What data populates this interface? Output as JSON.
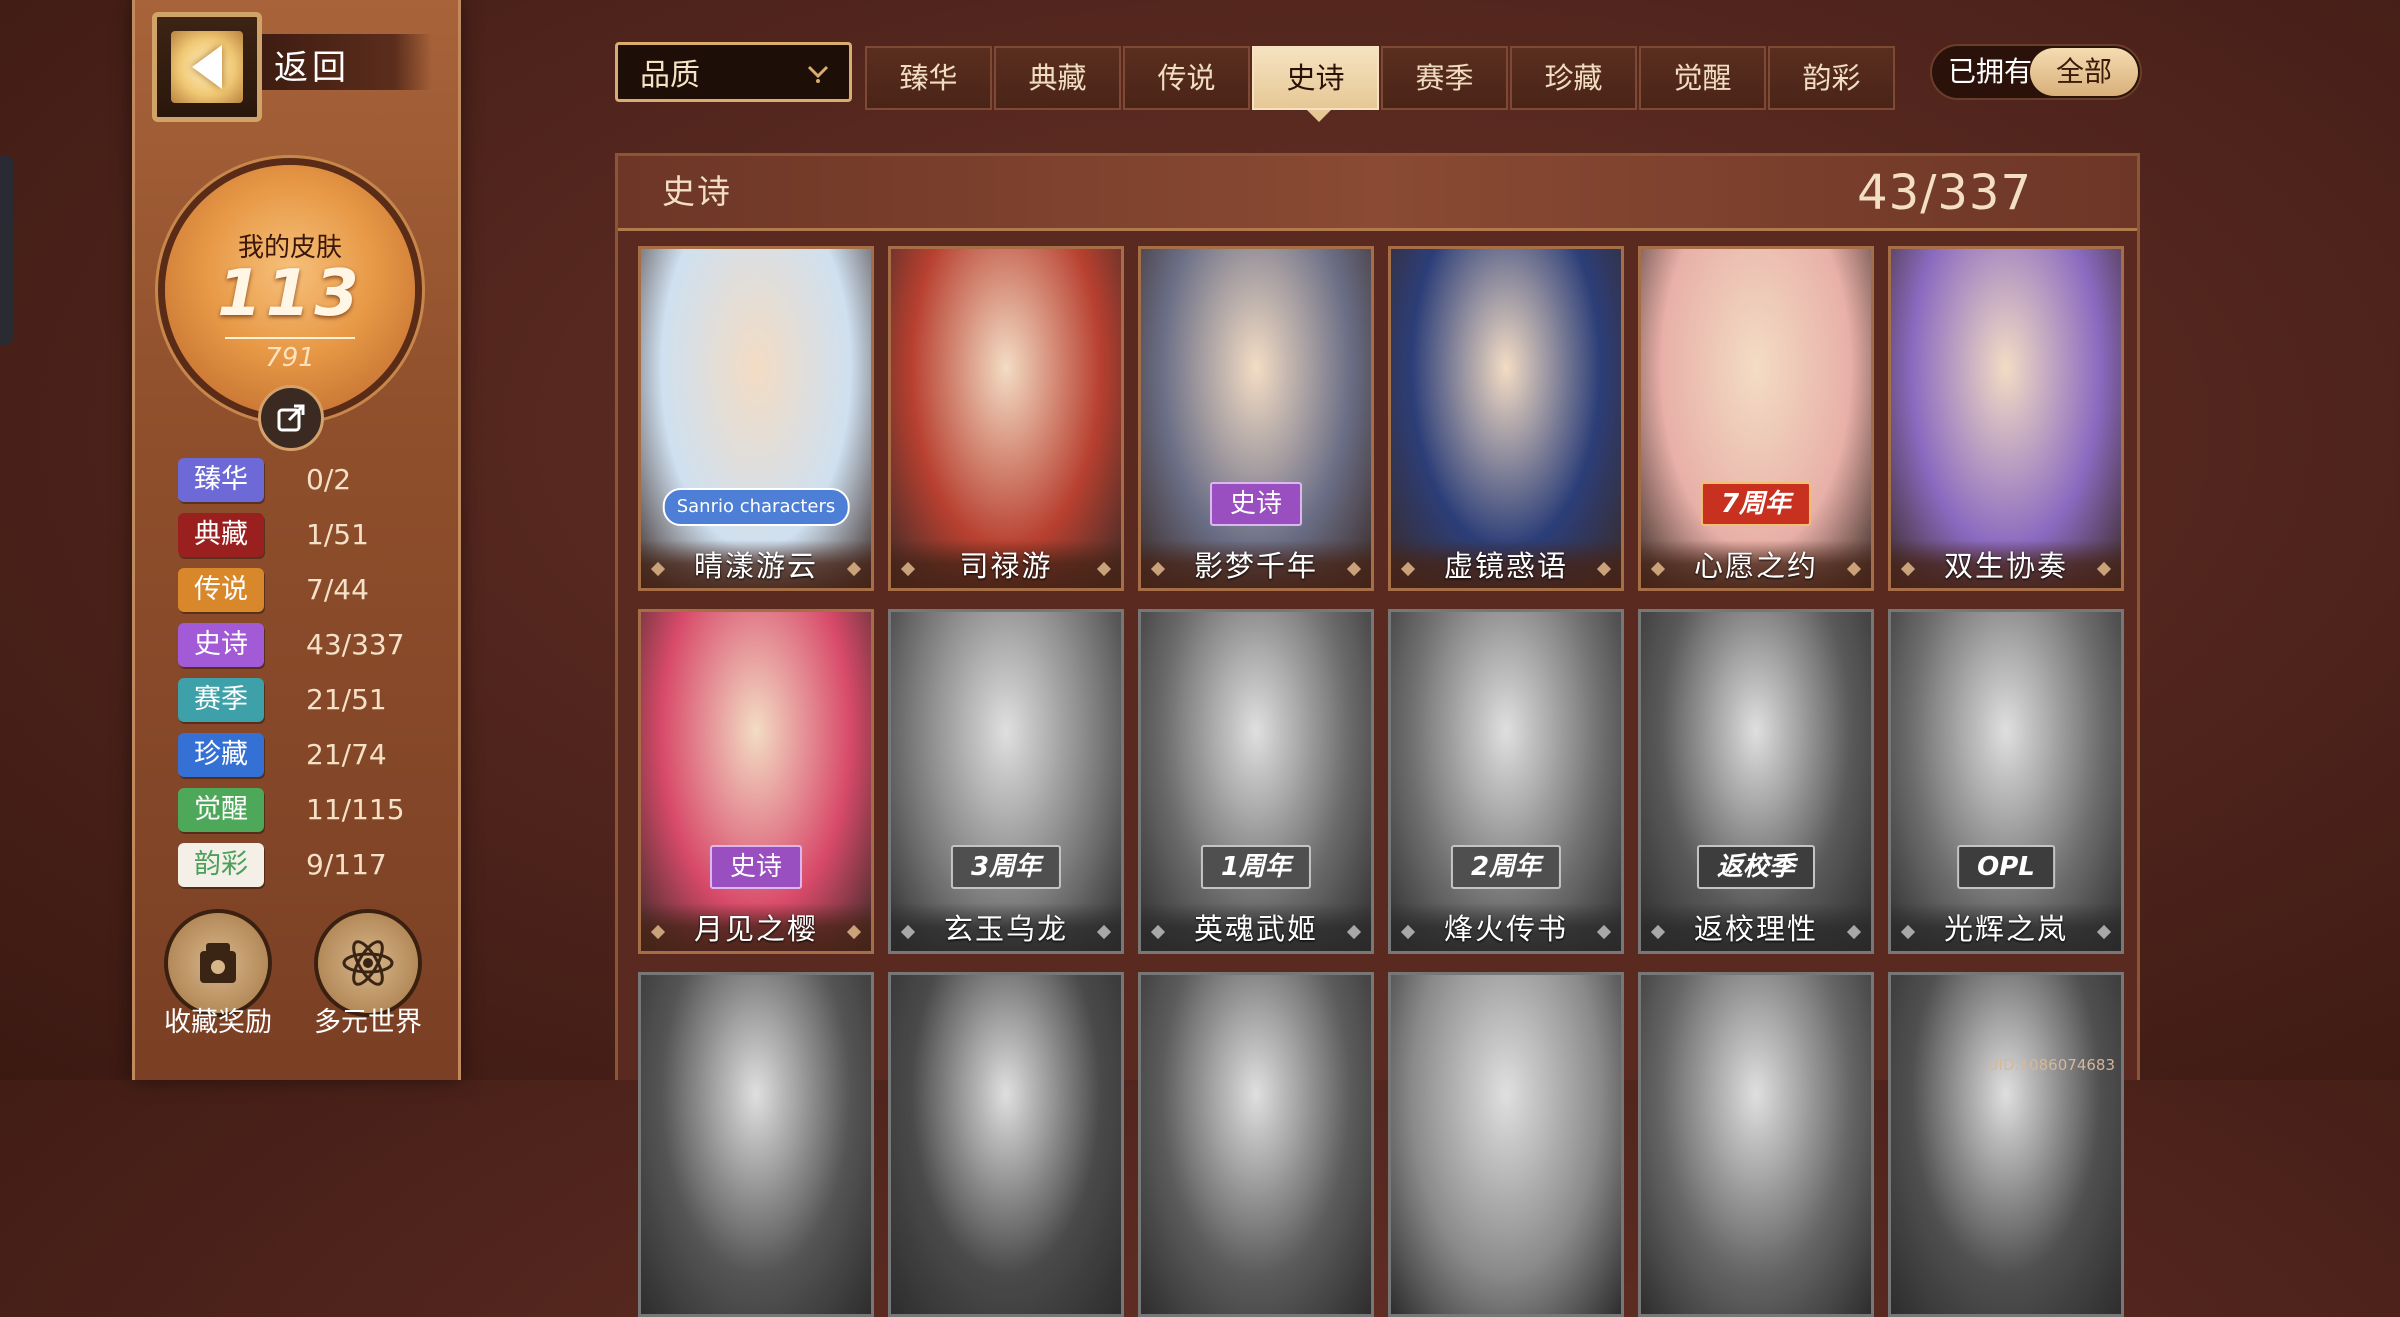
{
  "nav": {
    "back_label": "返回"
  },
  "my_skins": {
    "title": "我的皮肤",
    "owned": "113",
    "total": "791"
  },
  "quality_summary": [
    {
      "label": "臻华",
      "count": "0/2",
      "color": "#6d6ad8"
    },
    {
      "label": "典藏",
      "count": "1/51",
      "color": "#9a2020"
    },
    {
      "label": "传说",
      "count": "7/44",
      "color": "#d8882a"
    },
    {
      "label": "史诗",
      "count": "43/337",
      "color": "#a35ad6"
    },
    {
      "label": "赛季",
      "count": "21/51",
      "color": "#3ea0a8"
    },
    {
      "label": "珍藏",
      "count": "21/74",
      "color": "#3570d4"
    },
    {
      "label": "觉醒",
      "count": "11/115",
      "color": "#4ea85a"
    },
    {
      "label": "韵彩",
      "count": "9/117",
      "color": "#f4f0e8"
    }
  ],
  "bottom_actions": {
    "rewards_label": "收藏奖励",
    "multiverse_label": "多元世界"
  },
  "filter": {
    "label": "品质"
  },
  "tabs": [
    {
      "label": "臻华",
      "active": false
    },
    {
      "label": "典藏",
      "active": false
    },
    {
      "label": "传说",
      "active": false
    },
    {
      "label": "史诗",
      "active": true
    },
    {
      "label": "赛季",
      "active": false
    },
    {
      "label": "珍藏",
      "active": false
    },
    {
      "label": "觉醒",
      "active": false
    },
    {
      "label": "韵彩",
      "active": false
    }
  ],
  "owned_filter": {
    "label": "已拥有",
    "button": "全部"
  },
  "panel": {
    "title": "史诗",
    "count": "43/337"
  },
  "cards": [
    {
      "name": "晴漾游云",
      "badge": "Sanrio characters",
      "badge_type": "sanrio",
      "owned": true,
      "color": "#cfe0f0"
    },
    {
      "name": "司禄游",
      "badge": "",
      "badge_type": "",
      "owned": true,
      "color": "#b84030"
    },
    {
      "name": "影梦千年",
      "badge": "史诗",
      "badge_type": "epic",
      "owned": true,
      "color": "#6a6e86"
    },
    {
      "name": "虚镜惑语",
      "badge": "",
      "badge_type": "",
      "owned": true,
      "color": "#2c3e78"
    },
    {
      "name": "心愿之约",
      "badge": "7周年",
      "badge_type": "anniv",
      "owned": true,
      "color": "#e8b0a8"
    },
    {
      "name": "双生协奏",
      "badge": "",
      "badge_type": "",
      "owned": true,
      "color": "#8a6ac0"
    },
    {
      "name": "月见之樱",
      "badge": "史诗",
      "badge_type": "epic",
      "owned": true,
      "color": "#d84a6a"
    },
    {
      "name": "玄玉乌龙",
      "badge": "3周年",
      "badge_type": "anniv",
      "owned": false,
      "color": "#7a7a7a"
    },
    {
      "name": "英魂武姬",
      "badge": "1周年",
      "badge_type": "anniv",
      "owned": false,
      "color": "#6a6a6a"
    },
    {
      "name": "烽火传书",
      "badge": "2周年",
      "badge_type": "anniv",
      "owned": false,
      "color": "#707070"
    },
    {
      "name": "返校理性",
      "badge": "返校季",
      "badge_type": "logo",
      "owned": false,
      "color": "#5a5a5a"
    },
    {
      "name": "光辉之岚",
      "badge": "OPL",
      "badge_type": "logo",
      "owned": false,
      "color": "#6e6e6e"
    },
    {
      "name": "",
      "badge": "",
      "badge_type": "",
      "owned": false,
      "color": "#555555"
    },
    {
      "name": "",
      "badge": "",
      "badge_type": "",
      "owned": false,
      "color": "#4a4a4a"
    },
    {
      "name": "",
      "badge": "",
      "badge_type": "",
      "owned": false,
      "color": "#5c5c5c"
    },
    {
      "name": "",
      "badge": "",
      "badge_type": "",
      "owned": false,
      "color": "#8a8a8a"
    },
    {
      "name": "",
      "badge": "",
      "badge_type": "",
      "owned": false,
      "color": "#666666"
    },
    {
      "name": "",
      "badge": "",
      "badge_type": "",
      "owned": false,
      "color": "#505050"
    }
  ],
  "uid": "UID:1086074683"
}
